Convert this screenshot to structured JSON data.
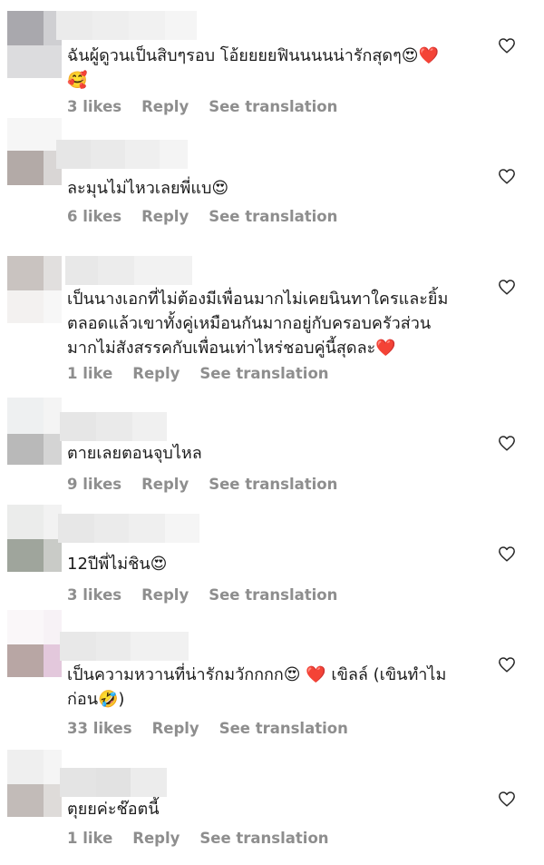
{
  "comments": [
    {
      "text": "ฉันผู้ดูวนเป็นสิบๆรอบ โอ้ยยยยฟินนนนน่ารักสุดๆ😍❤️\n🥰",
      "likes": "3 likes",
      "reply": "Reply",
      "translate": "See translation"
    },
    {
      "text": "ละมุนไม่ไหวเลยพี่แบ😍",
      "likes": "6 likes",
      "reply": "Reply",
      "translate": "See translation"
    },
    {
      "text": "เป็นนางเอกที่ไม่ต้องมีเพื่อนมากไม่เคยนินทาใครและยิ้ม\nตลอดแล้วเขาทั้งคู่เหมือนกันมากอยู่กับครอบครัวส่วน\nมากไม่สังสรรคกับเพื่อนเท่าไหร่ชอบคู่นี้สุดละ❤️",
      "likes": "1 like",
      "reply": "Reply",
      "translate": "See translation"
    },
    {
      "text": "ตายเลยตอนจุบไหล",
      "likes": "9 likes",
      "reply": "Reply",
      "translate": "See translation"
    },
    {
      "text": "12ปีพี่ไม่ชิน😍",
      "likes": "3 likes",
      "reply": "Reply",
      "translate": "See translation"
    },
    {
      "text": "เป็นความหวานที่น่ารักมวักกกก😍 ❤️  เขิลล์ (เขินทำไม\nก่อน🤣)",
      "likes": "33 likes",
      "reply": "Reply",
      "translate": "See translation"
    },
    {
      "text": "ตุยยค่ะช๊อตนี้",
      "likes": "1 like",
      "reply": "Reply",
      "translate": "See translation"
    }
  ],
  "colors": {
    "text": "#1c1c1c",
    "meta": "#8e8e8e",
    "heart_outline": "#262626",
    "emoji_heart": "#e0245e"
  },
  "icons": {
    "like_button": "heart-outline-icon"
  }
}
